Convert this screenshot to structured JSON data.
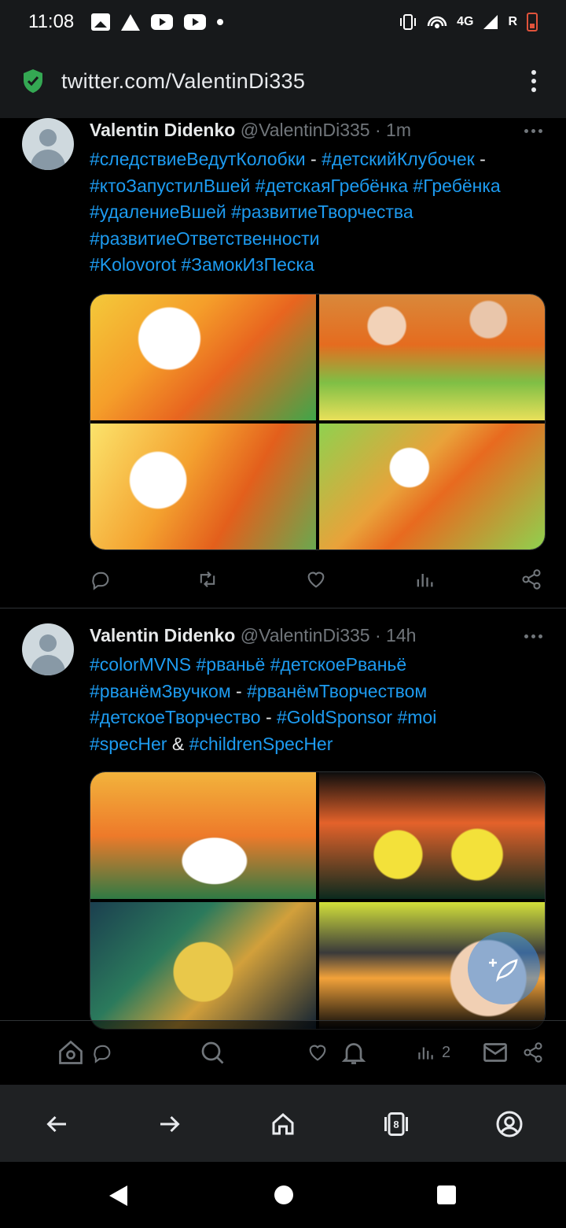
{
  "status_bar": {
    "time": "11:08",
    "network": "4G",
    "roaming": "R"
  },
  "url_bar": {
    "url": "twitter.com/ValentinDi335"
  },
  "tweets": [
    {
      "name": "Valentin Didenko",
      "handle": "@ValentinDi335",
      "time": "1m",
      "text_lines": [
        [
          {
            "t": "#следствиеВедутКолобки",
            "tag": true
          },
          {
            "t": " - ",
            "tag": false
          },
          {
            "t": "#детскийКлубочек",
            "tag": true
          },
          {
            "t": " -",
            "tag": false
          }
        ],
        [
          {
            "t": "#ктоЗапустилВшей",
            "tag": true
          },
          {
            "t": " ",
            "tag": false
          },
          {
            "t": "#детскаяГребёнка",
            "tag": true
          },
          {
            "t": " ",
            "tag": false
          },
          {
            "t": "#Гребёнка",
            "tag": true
          }
        ],
        [
          {
            "t": "#удалениеВшей",
            "tag": true
          },
          {
            "t": " ",
            "tag": false
          },
          {
            "t": "#развитиеТворчества",
            "tag": true
          }
        ],
        [
          {
            "t": "#развитиеОтветственности",
            "tag": true
          }
        ],
        [
          {
            "t": "#Kolovorot",
            "tag": true
          },
          {
            "t": " ",
            "tag": false
          },
          {
            "t": "#ЗамокИзПеска",
            "tag": true
          }
        ]
      ]
    },
    {
      "name": "Valentin Didenko",
      "handle": "@ValentinDi335",
      "time": "14h",
      "text_lines": [
        [
          {
            "t": "#colorMVNS",
            "tag": true
          },
          {
            "t": " ",
            "tag": false
          },
          {
            "t": "#рваньё",
            "tag": true
          },
          {
            "t": " ",
            "tag": false
          },
          {
            "t": "#детскоеРваньё",
            "tag": true
          }
        ],
        [
          {
            "t": "#рванёмЗвучком",
            "tag": true
          },
          {
            "t": " - ",
            "tag": false
          },
          {
            "t": "#рванёмТворчеством",
            "tag": true
          }
        ],
        [
          {
            "t": "#детскоеТворчество",
            "tag": true
          },
          {
            "t": " - ",
            "tag": false
          },
          {
            "t": "#GoldSponsor",
            "tag": true
          },
          {
            "t": " ",
            "tag": false
          },
          {
            "t": "#moi",
            "tag": true
          }
        ],
        [
          {
            "t": "#specHer",
            "tag": true
          },
          {
            "t": " & ",
            "tag": false
          },
          {
            "t": "#childrenSpecHer",
            "tag": true
          }
        ]
      ],
      "views_count": "2"
    }
  ],
  "browser_nav": {
    "tab_count": "8"
  },
  "colors": {
    "link": "#1d9bf0",
    "text": "#e7e9ea",
    "muted": "#71767b",
    "browser_chrome": "#17191b",
    "secure_shield": "#34a853"
  },
  "icons": {
    "reply": "speech-bubble-icon",
    "retweet": "retweet-icon",
    "like": "heart-icon",
    "views": "bar-chart-icon",
    "share": "share-icon"
  }
}
